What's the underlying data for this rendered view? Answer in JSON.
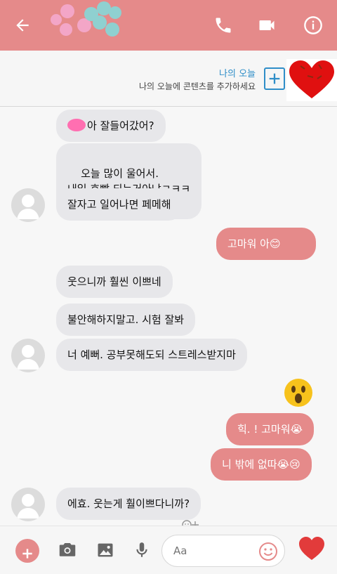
{
  "header": {
    "back_icon": "back-arrow-icon",
    "call_icon": "phone-icon",
    "video_icon": "video-camera-icon",
    "info_icon": "info-icon"
  },
  "story": {
    "title": "나의 오늘",
    "subtitle": "나의 오늘에 콘텐츠를 추가하세요",
    "add_icon": "plus-icon"
  },
  "messages": [
    {
      "side": "in",
      "text": "아 잘들어갔어?"
    },
    {
      "side": "in",
      "text": "오늘 많이 울어서.\n내일 호빵 되는거아냐ㅋㅋㅋ"
    },
    {
      "side": "in",
      "text": "잘자고 일어나면 페메해"
    },
    {
      "side": "out",
      "text": "고마워 아😊"
    },
    {
      "side": "in",
      "text": "웃으니까 훨씬 이쁘네"
    },
    {
      "side": "in",
      "text": "불안해하지말고. 시험 잘봐"
    },
    {
      "side": "in",
      "text": "너 예뻐. 공부못해도되 스트레스받지마"
    },
    {
      "side": "out",
      "text": "힉. ! 고마워😭"
    },
    {
      "side": "out",
      "text": "니 밖에 없따😭😢"
    },
    {
      "side": "in",
      "text": "에효. 웃는게 훨이쁘다니까?"
    }
  ],
  "composer": {
    "placeholder": "Aa",
    "plus_icon": "plus-icon",
    "camera_icon": "camera-icon",
    "gallery_icon": "gallery-icon",
    "mic_icon": "microphone-icon",
    "emoji_icon": "smile-icon",
    "like_icon": "heart-icon"
  },
  "colors": {
    "accent": "#e58a8a",
    "story_blue": "#2f8ec8",
    "incoming_bubble": "#e7e7ea"
  }
}
